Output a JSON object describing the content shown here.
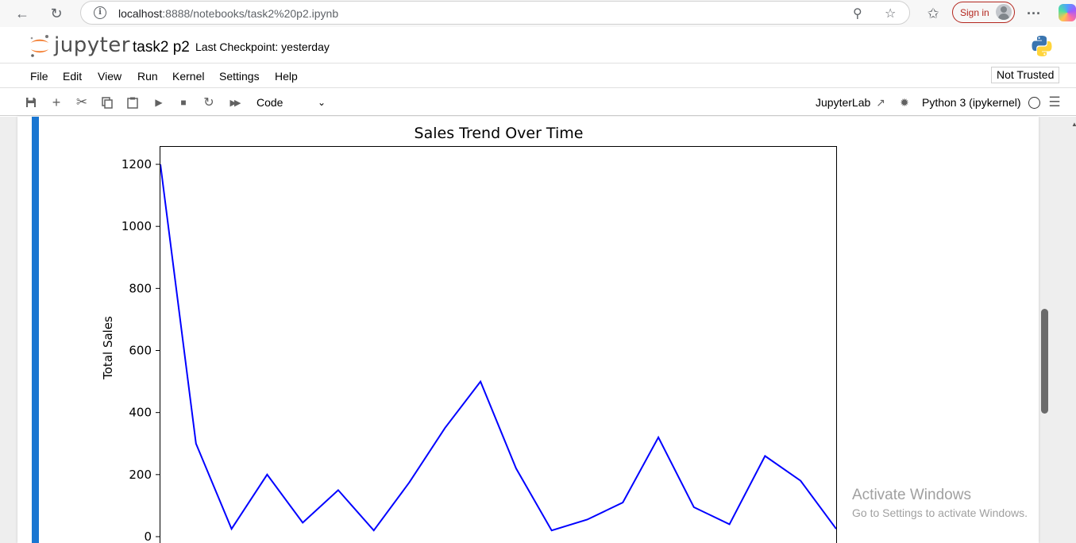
{
  "browser": {
    "url_host": "localhost",
    "url_path": ":8888/notebooks/task2%20p2.ipynb",
    "signin_label": "Sign in",
    "more_label": "···"
  },
  "jupyter": {
    "wordmark": "jupyter",
    "notebook_name": "task2 p2",
    "checkpoint": "Last Checkpoint: yesterday"
  },
  "menu": {
    "items": [
      "File",
      "Edit",
      "View",
      "Run",
      "Kernel",
      "Settings",
      "Help"
    ],
    "not_trusted": "Not Trusted"
  },
  "toolbar": {
    "cell_type": "Code",
    "jupyterlab_label": "JupyterLab",
    "kernel_label": "Python 3 (ipykernel)"
  },
  "colors": {
    "accent": "#1976d2",
    "line": "#0000ff",
    "signin": "#b3261e"
  },
  "chart_data": {
    "type": "line",
    "title": "Sales Trend Over Time",
    "ylabel": "Total Sales",
    "xlabel": "",
    "yticks": [
      0,
      200,
      400,
      600,
      800,
      1000,
      1200
    ],
    "ylim": [
      -60,
      1260
    ],
    "series": [
      {
        "values": [
          1200,
          300,
          25,
          200,
          45,
          150,
          20,
          175,
          350,
          500,
          220,
          20,
          55,
          110,
          320,
          95,
          40,
          260,
          180,
          25
        ]
      }
    ],
    "grid": false
  },
  "watermark": {
    "title": "Activate Windows",
    "subtitle": "Go to Settings to activate Windows."
  }
}
